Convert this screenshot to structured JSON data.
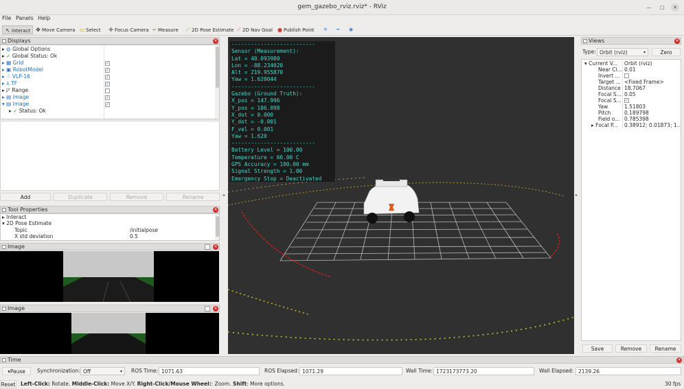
{
  "window": {
    "title": "gem_gazebo_rviz.rviz* - RViz"
  },
  "menu": [
    "File",
    "Panels",
    "Help"
  ],
  "toolbar": {
    "tools": [
      {
        "label": "Interact",
        "icon": "cursor-icon"
      },
      {
        "label": "Move Camera",
        "icon": "move-camera-icon"
      },
      {
        "label": "Select",
        "icon": "select-icon"
      },
      {
        "label": "Focus Camera",
        "icon": "focus-camera-icon"
      },
      {
        "label": "Measure",
        "icon": "measure-icon"
      },
      {
        "label": "2D Pose Estimate",
        "icon": "pose-estimate-icon"
      },
      {
        "label": "2D Nav Goal",
        "icon": "nav-goal-icon"
      },
      {
        "label": "Publish Point",
        "icon": "publish-point-icon"
      }
    ]
  },
  "displays": {
    "title": "Displays",
    "items": [
      {
        "label": "Global Options",
        "checked": null
      },
      {
        "label": "Global Status: Ok",
        "checked": null
      },
      {
        "label": "Grid",
        "checked": true
      },
      {
        "label": "RobotModel",
        "checked": true
      },
      {
        "label": "VLP-16",
        "checked": true
      },
      {
        "label": "TF",
        "checked": true
      },
      {
        "label": "Range",
        "checked": false
      },
      {
        "label": "Image",
        "checked": true
      },
      {
        "label": "Image",
        "checked": true
      },
      {
        "label": "Status: Ok",
        "checked": null
      }
    ],
    "buttons": {
      "add": "Add",
      "duplicate": "Duplicate",
      "remove": "Remove",
      "rename": "Rename"
    }
  },
  "tool_properties": {
    "title": "Tool Properties",
    "rows": [
      {
        "key": "Interact",
        "value": ""
      },
      {
        "key": "2D Pose Estimate",
        "value": ""
      },
      {
        "key": "Topic",
        "value": "/initialpose"
      },
      {
        "key": "X std deviation",
        "value": "0.5"
      }
    ]
  },
  "image_panels": [
    {
      "title": "Image"
    },
    {
      "title": "Image"
    }
  ],
  "overlay_lines": [
    "--------------------------",
    "Sensor (Measurement):",
    "Lat = 40.093980",
    "Lon = -88.234020",
    "Alt = 219.955870",
    "Yaw = 1.620044",
    "--------------------------",
    "Gazebo (Ground Truth):",
    "X_pos = 147.996",
    "Y_pos = 106.098",
    "X_dot = 0.000",
    "Y_dot = -0.001",
    "F_vel = 0.001",
    "Yaw = 1.620",
    "--------------------------",
    "Battery Level = 100.00",
    "Temperature = 60.00 C",
    "GPS Accuracy = 100.00 mm",
    "Signal Strength = 1.00",
    "Emergency Stop = Deactivated"
  ],
  "views": {
    "title": "Views",
    "type_label": "Type:",
    "type_value": "Orbit (rviz)",
    "zero": "Zero",
    "rows": [
      {
        "key": "Current V...",
        "value": "Orbit (rviz)"
      },
      {
        "key": "Near Cl...",
        "value": "0.01"
      },
      {
        "key": "Invert ...",
        "value": ""
      },
      {
        "key": "Target ...",
        "value": "<Fixed Frame>"
      },
      {
        "key": "Distance",
        "value": "18.7067"
      },
      {
        "key": "Focal S...",
        "value": "0.05"
      },
      {
        "key": "Focal S...",
        "value": "✓"
      },
      {
        "key": "Yaw",
        "value": "1.51803"
      },
      {
        "key": "Pitch",
        "value": "0.189798"
      },
      {
        "key": "Field o...",
        "value": "0.785398"
      },
      {
        "key": "Focal P...",
        "value": "0.38912; 0.01873; 1...."
      }
    ],
    "buttons": {
      "save": "Save",
      "remove": "Remove",
      "rename": "Rename"
    }
  },
  "time": {
    "title": "Time",
    "pause": "Pause",
    "sync_label": "Synchronization:",
    "sync_value": "Off",
    "ros_time_label": "ROS Time:",
    "ros_time": "1071.63",
    "ros_elapsed_label": "ROS Elapsed:",
    "ros_elapsed": "1071.29",
    "wall_time_label": "Wall Time:",
    "wall_time": "1723173773.20",
    "wall_elapsed_label": "Wall Elapsed:",
    "wall_elapsed": "2139.26"
  },
  "status": {
    "reset": "Reset",
    "hint_1": "Left-Click:",
    "hint_1b": " Rotate. ",
    "hint_2": "Middle-Click:",
    "hint_2b": " Move X/Y. ",
    "hint_3": "Right-Click/Mouse Wheel:",
    "hint_3b": ": Zoom. ",
    "hint_4": "Shift",
    "hint_4b": ": More options.",
    "fps": "30 fps"
  },
  "colors": {
    "overlay_text": "#3fd9c9",
    "accent_blue": "#1d6fc9",
    "close_red": "#d22c2c"
  }
}
